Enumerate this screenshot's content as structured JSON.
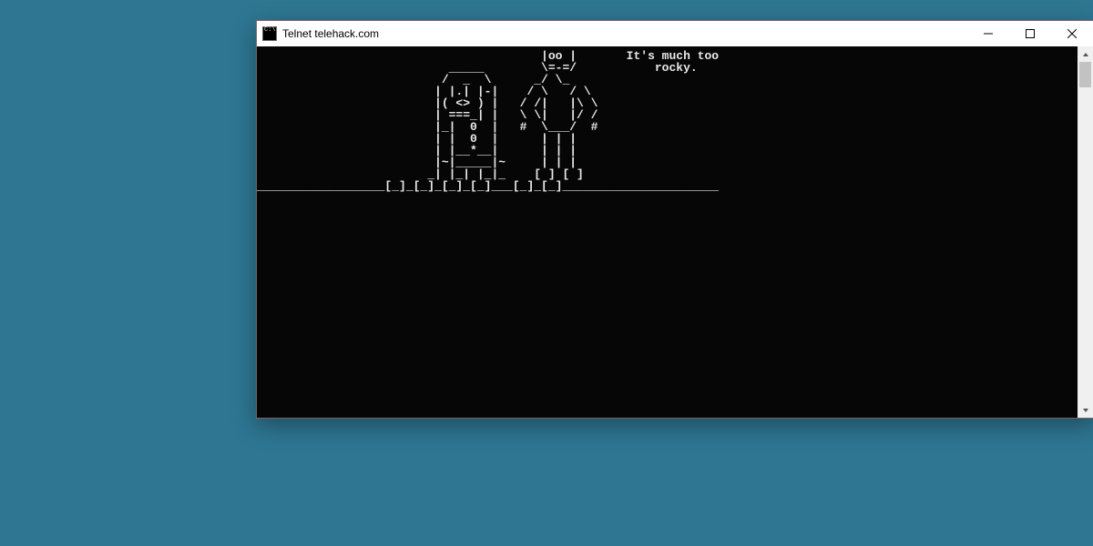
{
  "window": {
    "title": "Telnet telehack.com"
  },
  "terminal": {
    "ascii": "                                        |oo |       It's much too\n                           _____        \\=-=/           rocky.\n                          /  _  \\      _/ \\_\n                         | |.| |-|    / \\   / \\\n                         |( <> ) |   / /|   |\\ \\\n                         | ===_| |   \\ \\|   |/ /\n                         |_|  0  |   #  \\___/  #\n                         | |  0  |      | | |\n                         | |__*__|      | | |\n                         |~|_____|~     | | |\n                        _| |_| |_|_    [ ] [ ]\n__________________[_]_[_]_[_]_[_]___[_]_[_]______________________"
  }
}
